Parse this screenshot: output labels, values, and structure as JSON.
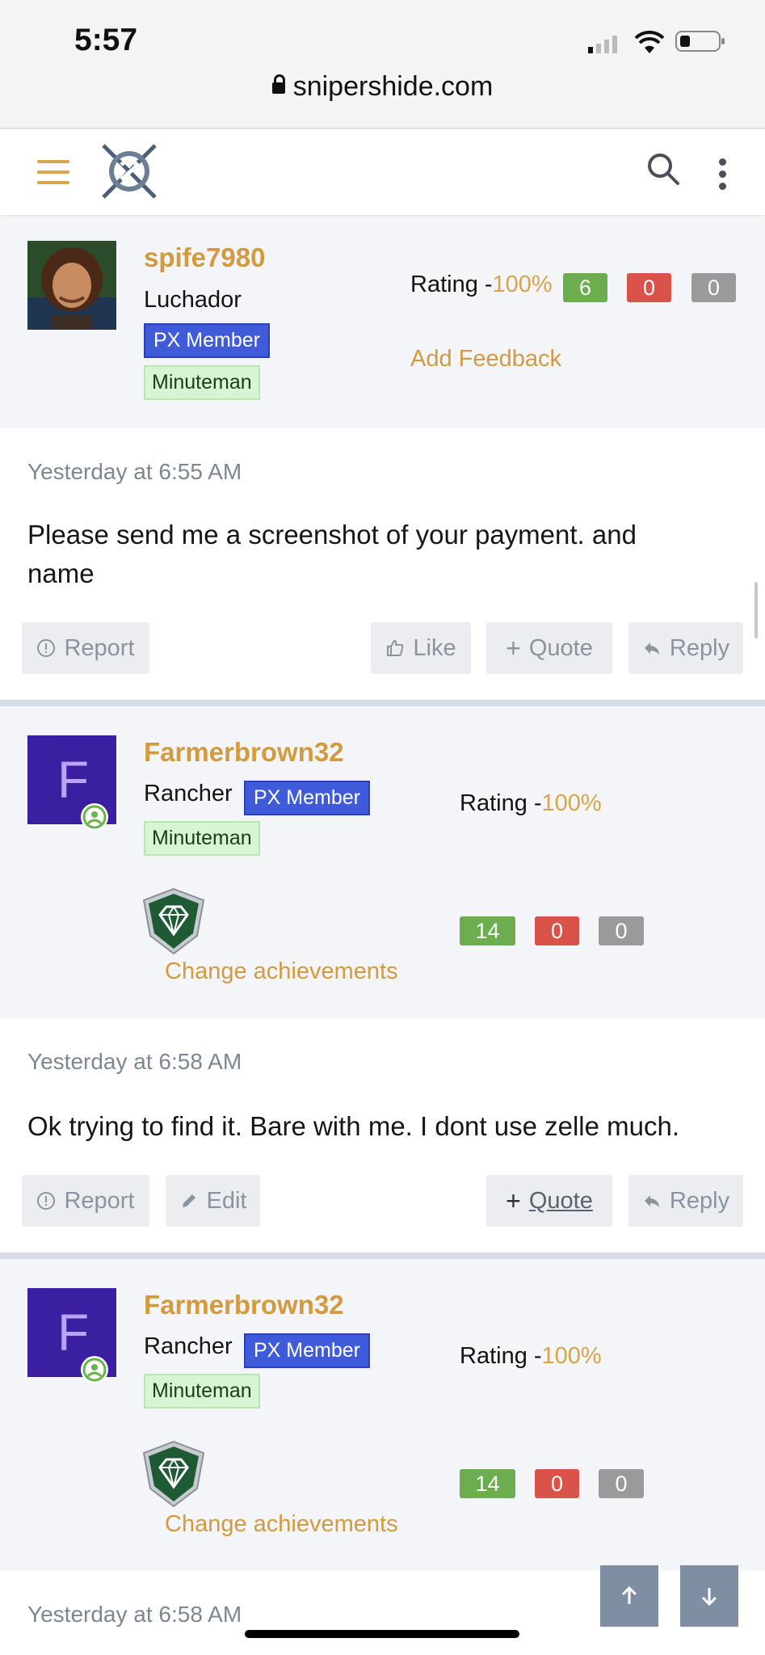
{
  "status": {
    "time": "5:57"
  },
  "browser": {
    "url": "snipershide.com"
  },
  "posts": [
    {
      "username": "spife7980",
      "user_title": "Luchador",
      "badge_px": "PX Member",
      "badge_rank": "Minuteman",
      "rating_label": "Rating -",
      "rating_pct": "100%",
      "pos": "6",
      "neu": "0",
      "neg": "0",
      "feedback": "Add Feedback",
      "date": "Yesterday at 6:55 AM",
      "text": "Please send me a screenshot of your payment. and name",
      "actions": {
        "report": "Report",
        "like": "Like",
        "quote": "Quote",
        "reply": "Reply"
      }
    },
    {
      "username": "Farmerbrown32",
      "avatar_letter": "F",
      "user_title": "Rancher",
      "badge_px": "PX Member",
      "badge_rank": "Minuteman",
      "rating_label": "Rating -",
      "rating_pct": "100%",
      "pos": "14",
      "neu": "0",
      "neg": "0",
      "achievements": "Change achievements",
      "date": "Yesterday at 6:58 AM",
      "text": "Ok trying to find it. Bare with me. I dont use zelle much.",
      "actions": {
        "report": "Report",
        "edit": "Edit",
        "quote": "Quote",
        "reply": "Reply"
      }
    },
    {
      "username": "Farmerbrown32",
      "avatar_letter": "F",
      "user_title": "Rancher",
      "badge_px": "PX Member",
      "badge_rank": "Minuteman",
      "rating_label": "Rating -",
      "rating_pct": "100%",
      "pos": "14",
      "neu": "0",
      "neg": "0",
      "achievements": "Change achievements",
      "date": "Yesterday at 6:58 AM"
    }
  ],
  "colors": {
    "accent": "#d39a3f",
    "px_badge": "#3f5bd9",
    "positive": "#6cad4f",
    "negative": "#d9534a",
    "neutral": "#9a9a9a"
  }
}
